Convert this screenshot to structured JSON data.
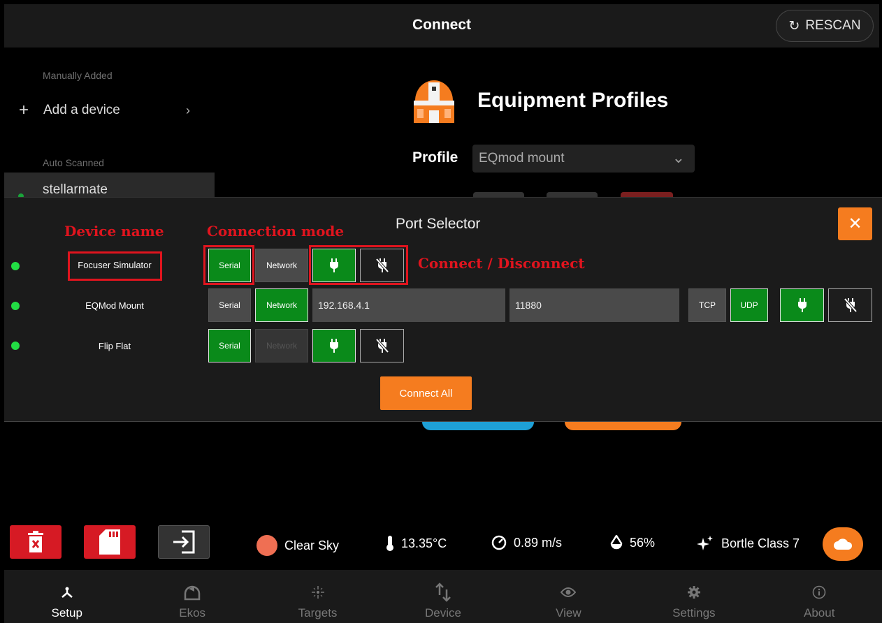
{
  "header": {
    "title": "Connect",
    "rescan_label": "RESCAN"
  },
  "devices_panel": {
    "manual_section": "Manually Added",
    "add_device_label": "Add a device",
    "auto_section": "Auto Scanned",
    "auto_devices": [
      {
        "name": "stellarmate"
      }
    ]
  },
  "profiles": {
    "title": "Equipment Profiles",
    "profile_label": "Profile",
    "selected_profile": "EQmod mount"
  },
  "port_selector": {
    "title": "Port Selector",
    "rows": [
      {
        "name": "Focuser Simulator",
        "serial": "Serial",
        "network": "Network",
        "mode": "serial"
      },
      {
        "name": "EQMod Mount",
        "serial": "Serial",
        "network": "Network",
        "mode": "network",
        "host": "192.168.4.1",
        "port": "11880",
        "tcp": "TCP",
        "udp": "UDP",
        "protocol": "udp"
      },
      {
        "name": "Flip Flat",
        "serial": "Serial",
        "network": "Network",
        "mode": "serial"
      }
    ],
    "connect_all_label": "Connect All"
  },
  "annotations": {
    "device_name": "Device name",
    "connection_mode": "Connection mode",
    "connect_disconnect": "Connect / Disconnect"
  },
  "status_bar": {
    "sky": "Clear Sky",
    "temperature": "13.35°C",
    "wind": "0.89 m/s",
    "humidity": "56%",
    "bortle": "Bortle Class 7"
  },
  "nav": [
    {
      "label": "Setup",
      "icon": "setup-icon",
      "active": true
    },
    {
      "label": "Ekos",
      "icon": "ekos-icon"
    },
    {
      "label": "Targets",
      "icon": "targets-icon"
    },
    {
      "label": "Device",
      "icon": "device-icon"
    },
    {
      "label": "View",
      "icon": "view-icon"
    },
    {
      "label": "Settings",
      "icon": "settings-icon"
    },
    {
      "label": "About",
      "icon": "about-icon"
    }
  ],
  "colors": {
    "accent": "#f57c1f",
    "active_green": "#0a8a1a",
    "status_green": "#22dd44",
    "danger": "#d61a24",
    "annotation": "#e0141e"
  }
}
